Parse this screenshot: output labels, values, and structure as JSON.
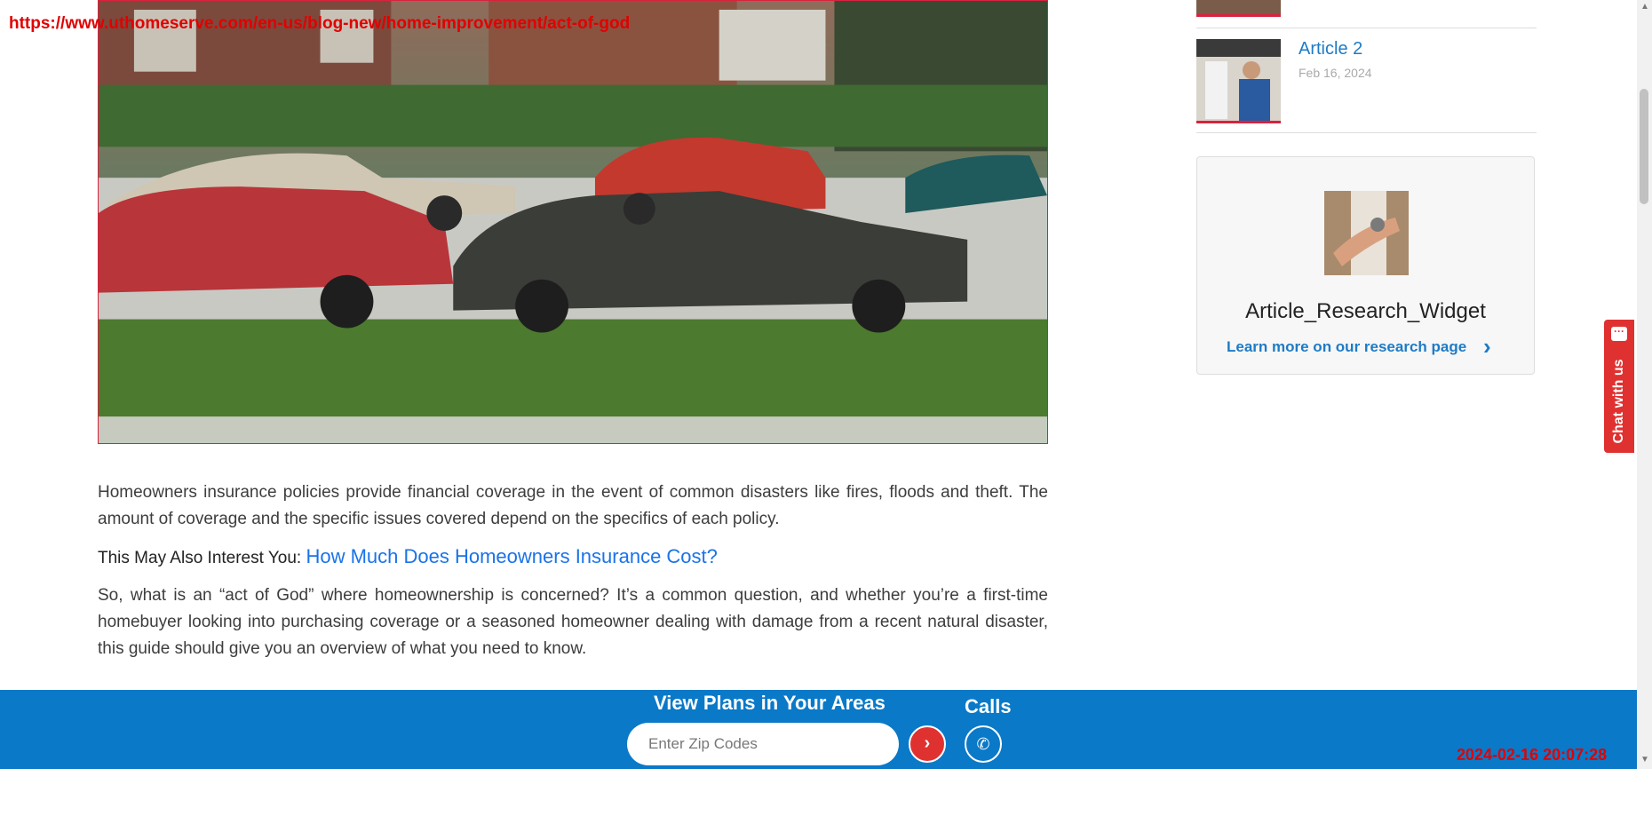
{
  "browser": {
    "url_overlay": "https://www.uthomeserve.com/en-us/blog-new/home-improvement/act-of-god",
    "timestamp": "2024-02-16 20:07:28"
  },
  "hero": {
    "alt": "Cars parked on a hail covered street"
  },
  "article": {
    "paragraph1": "Homeowners insurance policies provide financial coverage in the event of common disasters like fires, floods and theft. The amount of coverage and the specific issues covered depend on the specifics of each policy.",
    "interest_prefix": "This May Also Interest You: ",
    "interest_link": "How Much Does Homeowners Insurance Cost?",
    "paragraph2": "So, what is an “act of God” where homeownership is concerned? It’s a common question, and whether you’re a first-time homebuyer looking into purchasing coverage or a seasoned homeowner dealing with damage from a recent natural disaster, this guide should give you an overview of what you need to know."
  },
  "sidebar": {
    "article2_title": "Article 2",
    "article2_date": "Feb 16, 2024",
    "widget_title": "Article_Research_Widget",
    "widget_link": "Learn more on our research page"
  },
  "chat": {
    "label": "Chat with us"
  },
  "footer": {
    "title": "View Plans in Your Areas",
    "zip_placeholder": "Enter Zip Codes",
    "calls_label": "Calls"
  },
  "colors": {
    "accent_red": "#e03131",
    "brand_blue": "#0a79c8",
    "link_blue": "#1a73e8"
  }
}
